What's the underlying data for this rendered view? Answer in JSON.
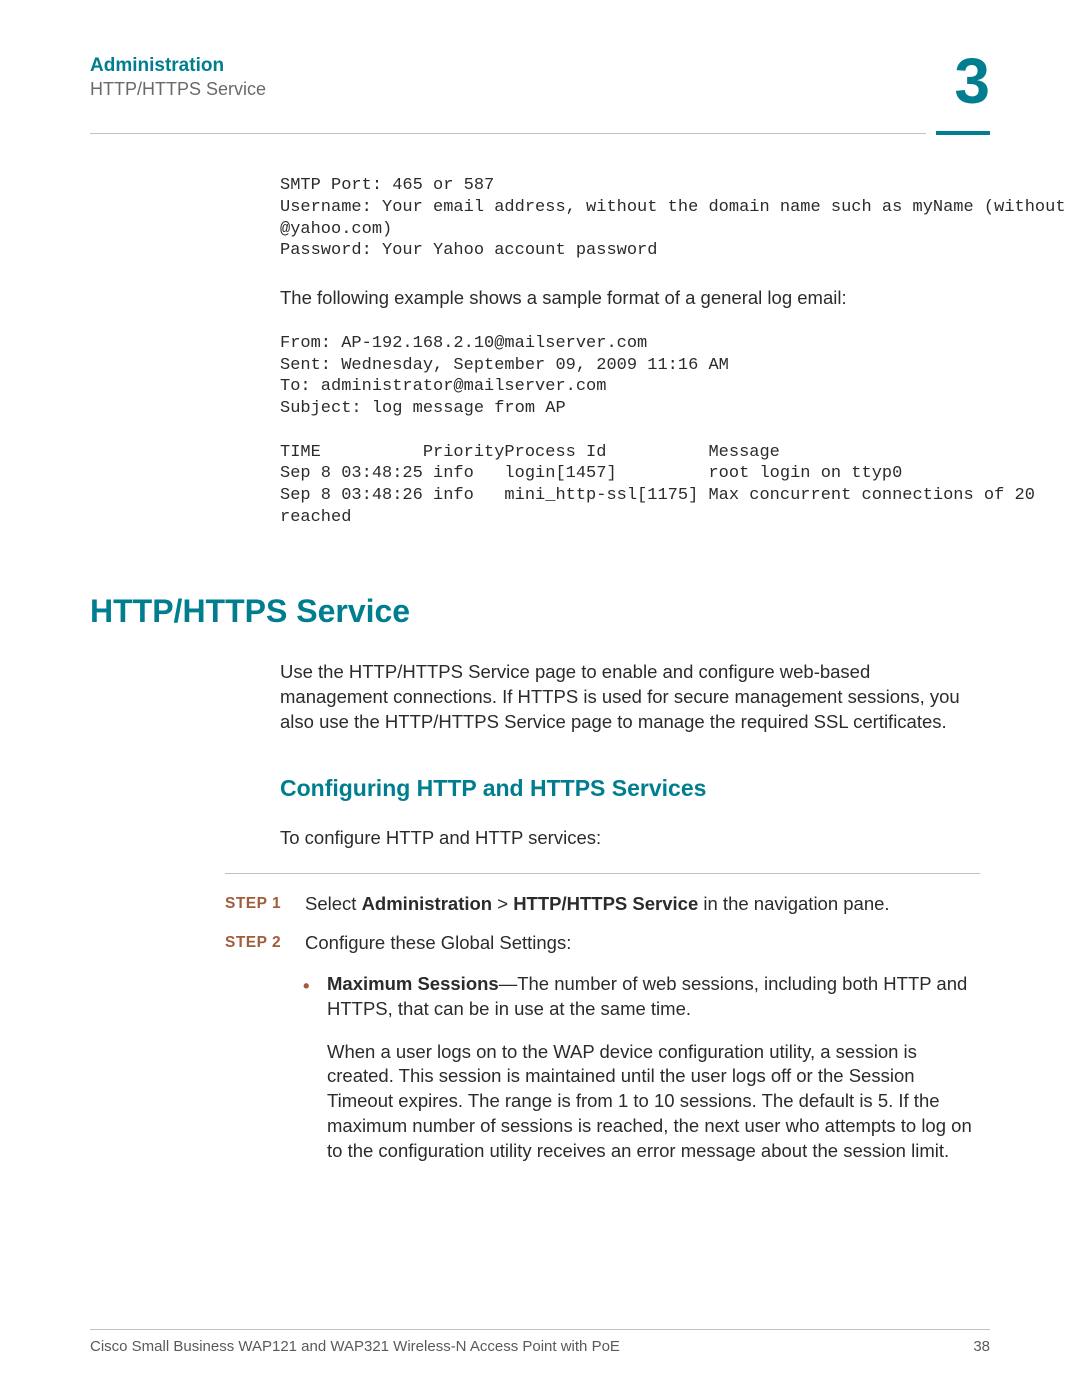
{
  "header": {
    "chapter_title": "Administration",
    "section_title": "HTTP/HTTPS Service",
    "chapter_number": "3"
  },
  "smtp_block": "SMTP Port: 465 or 587\nUsername: Your email address, without the domain name such as myName (without\n@yahoo.com)\nPassword: Your Yahoo account password",
  "example_intro": "The following example shows a sample format of a general log email:",
  "email_block": "From: AP-192.168.2.10@mailserver.com\nSent: Wednesday, September 09, 2009 11:16 AM\nTo: administrator@mailserver.com\nSubject: log message from AP\n\nTIME          PriorityProcess Id          Message\nSep 8 03:48:25 info   login[1457]         root login on ttyp0\nSep 8 03:48:26 info   mini_http-ssl[1175] Max concurrent connections of 20\nreached",
  "main_heading": "HTTP/HTTPS Service",
  "intro_para": "Use the HTTP/HTTPS Service page to enable and configure web-based management connections. If HTTPS is used for secure management sessions, you also use the HTTP/HTTPS Service page to manage the required SSL certificates.",
  "sub_heading": "Configuring HTTP and HTTPS Services",
  "config_intro": "To configure HTTP and HTTP services:",
  "steps": {
    "step1_label": "STEP  1",
    "step1_prefix": "Select ",
    "step1_bold1": "Administration",
    "step1_sep": " > ",
    "step1_bold2": "HTTP/HTTPS Service",
    "step1_suffix": " in the navigation pane.",
    "step2_label": "STEP  2",
    "step2_text": "Configure these Global Settings:"
  },
  "bullet": {
    "title": "Maximum Sessions",
    "desc": "—The number of web sessions, including both HTTP and HTTPS, that can be in use at the same time.",
    "para2": "When a user logs on to the WAP device configuration utility, a session is created. This session is maintained until the user logs off or the Session Timeout expires. The range is from 1 to 10 sessions. The default is 5. If the maximum number of sessions is reached, the next user who attempts to log on to the configuration utility receives an error message about the session limit."
  },
  "footer": {
    "left": "Cisco Small Business WAP121 and WAP321 Wireless-N Access Point with PoE",
    "right": "38"
  }
}
